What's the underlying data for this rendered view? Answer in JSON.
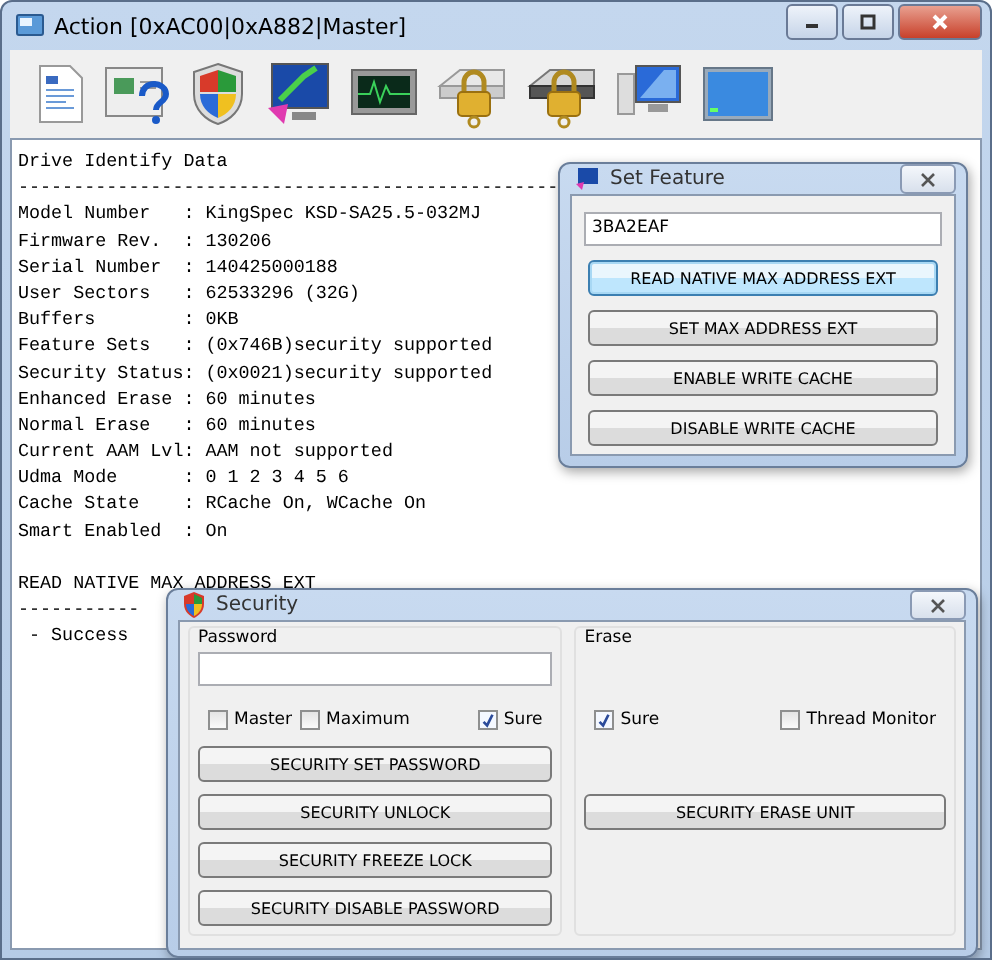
{
  "window": {
    "title": "Action [0xAC00|0xA882|Master]"
  },
  "log": [
    {
      "title": "Drive Identify Data",
      "rule": "-------------------------------------------------",
      "lines": [
        "Model Number   : KingSpec KSD-SA25.5-032MJ",
        "Firmware Rev.  : 130206",
        "Serial Number  : 140425000188",
        "User Sectors   : 62533296 (32G)",
        "Buffers        : 0KB",
        "Feature Sets   : (0x746B)security supported",
        "Security Status: (0x0021)security supported",
        "Enhanced Erase : 60 minutes",
        "Normal Erase   : 60 minutes",
        "Current AAM Lvl: AAM not supported",
        "Udma Mode      : 0 1 2 3 4 5 6",
        "Cache State    : RCache On, WCache On",
        "Smart Enabled  : On"
      ]
    },
    {
      "title": "READ NATIVE MAX ADDRESS EXT",
      "rule": "-----------",
      "lines": [
        " - Success"
      ]
    }
  ],
  "set_feature": {
    "title": "Set Feature",
    "value": "3BA2EAF",
    "buttons": [
      {
        "label": "READ NATIVE MAX ADDRESS EXT",
        "default": true
      },
      {
        "label": "SET MAX ADDRESS EXT",
        "default": false
      },
      {
        "label": "ENABLE WRITE CACHE",
        "default": false
      },
      {
        "label": "DISABLE WRITE CACHE",
        "default": false
      }
    ]
  },
  "security": {
    "title": "Security",
    "password": {
      "label": "Password",
      "checkboxes": [
        {
          "label": "Master",
          "checked": false
        },
        {
          "label": "Maximum",
          "checked": false
        },
        {
          "label": "Sure",
          "checked": true
        }
      ],
      "buttons": [
        "SECURITY SET PASSWORD",
        "SECURITY UNLOCK",
        "SECURITY FREEZE LOCK",
        "SECURITY DISABLE PASSWORD"
      ]
    },
    "erase": {
      "label": "Erase",
      "checkboxes": [
        {
          "label": "Sure",
          "checked": true
        },
        {
          "label": "Thread Monitor",
          "checked": false
        }
      ],
      "buttons": [
        "SECURITY ERASE UNIT"
      ]
    }
  }
}
